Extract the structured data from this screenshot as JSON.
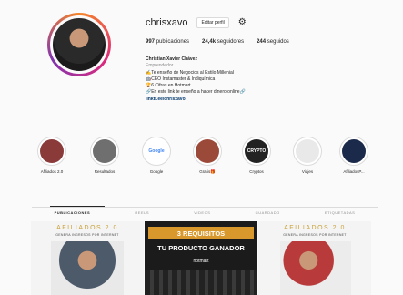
{
  "profile": {
    "username": "chrisxavo",
    "edit_label": "Editar perfil",
    "stats": [
      {
        "count": "997",
        "label": "publicaciones"
      },
      {
        "count": "24,4k",
        "label": "seguidores"
      },
      {
        "count": "244",
        "label": "seguidos"
      }
    ],
    "bio": {
      "name": "Christian Xavier Chávez",
      "category": "Emprendedor",
      "lines": [
        "✍️Te enseño de Negocios al Estilo Millenial",
        "🤖CEO Instamaster & Indiquímica",
        "🏆6 Cifras en Hotmart",
        "🔗En este link te enseño a hacer dinero online🔗"
      ],
      "link": "linktr.ee/chrisxavo"
    }
  },
  "highlights": [
    {
      "label": "Afiliados 2.0",
      "color": "#8b3a3a",
      "text": ""
    },
    {
      "label": "Resultados",
      "color": "#6f6f6f",
      "text": ""
    },
    {
      "label": "Google",
      "color": "#ffffff",
      "text": "Google"
    },
    {
      "label": "Gratis🎁",
      "color": "#9b4a3a",
      "text": ""
    },
    {
      "label": "Cryptos",
      "color": "#222222",
      "text": "CRYPTO"
    },
    {
      "label": "Viajes",
      "color": "#e9e9e9",
      "text": ""
    },
    {
      "label": "AfiliadosP...",
      "color": "#1b2a4a",
      "text": ""
    }
  ],
  "tabs": [
    {
      "label": "PUBLICACIONES",
      "active": true
    },
    {
      "label": "REELS",
      "active": false
    },
    {
      "label": "VIDEOS",
      "active": false
    },
    {
      "label": "GUARDADO",
      "active": false
    },
    {
      "label": "ETIQUETADAS",
      "active": false
    }
  ],
  "posts": [
    {
      "title": "AFILIADOS 2.0",
      "subtitle": "GENERA INGRESOS POR INTERNET"
    },
    {
      "banner": "3 REQUISITOS",
      "headline": "TU PRODUCTO GANADOR",
      "logo": "hotmart"
    },
    {
      "title": "AFILIADOS 2.0",
      "subtitle": "GENERA INGRESOS POR INTERNET"
    }
  ]
}
